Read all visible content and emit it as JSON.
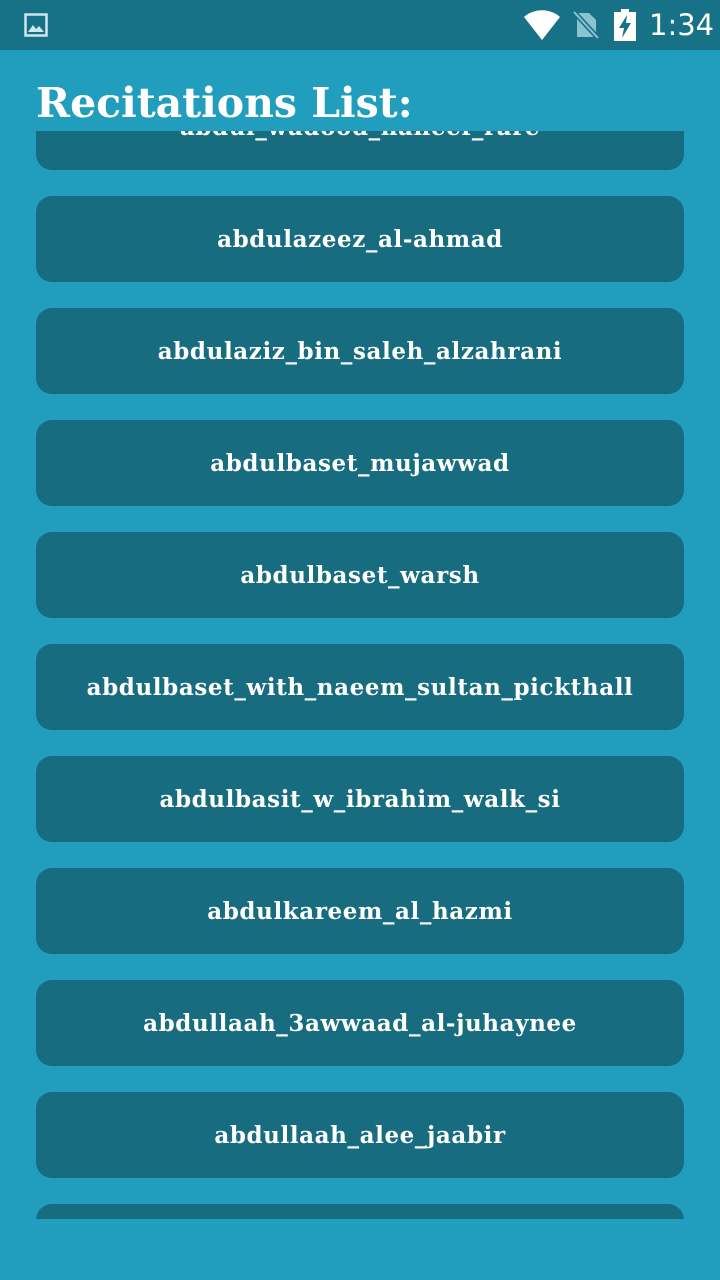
{
  "status_bar": {
    "time": "1:34",
    "icons": [
      "gallery-icon",
      "wifi-icon",
      "no-sim-icon",
      "battery-charging-icon"
    ]
  },
  "colors": {
    "background": "#219dbd",
    "status_bar": "#187287",
    "list_item": "#176c80",
    "text": "#ffffff"
  },
  "page": {
    "title": "Recitations List:"
  },
  "recitations": [
    {
      "label": "abdul_wadood_haneef_rare"
    },
    {
      "label": "abdulazeez_al-ahmad"
    },
    {
      "label": "abdulaziz_bin_saleh_alzahrani"
    },
    {
      "label": "abdulbaset_mujawwad"
    },
    {
      "label": "abdulbaset_warsh"
    },
    {
      "label": "abdulbaset_with_naeem_sultan_pickthall"
    },
    {
      "label": "abdulbasit_w_ibrahim_walk_si"
    },
    {
      "label": "abdulkareem_al_hazmi"
    },
    {
      "label": "abdullaah_3awwaad_al-juhaynee"
    },
    {
      "label": "abdullaah_alee_jaabir"
    },
    {
      "label": ""
    }
  ]
}
